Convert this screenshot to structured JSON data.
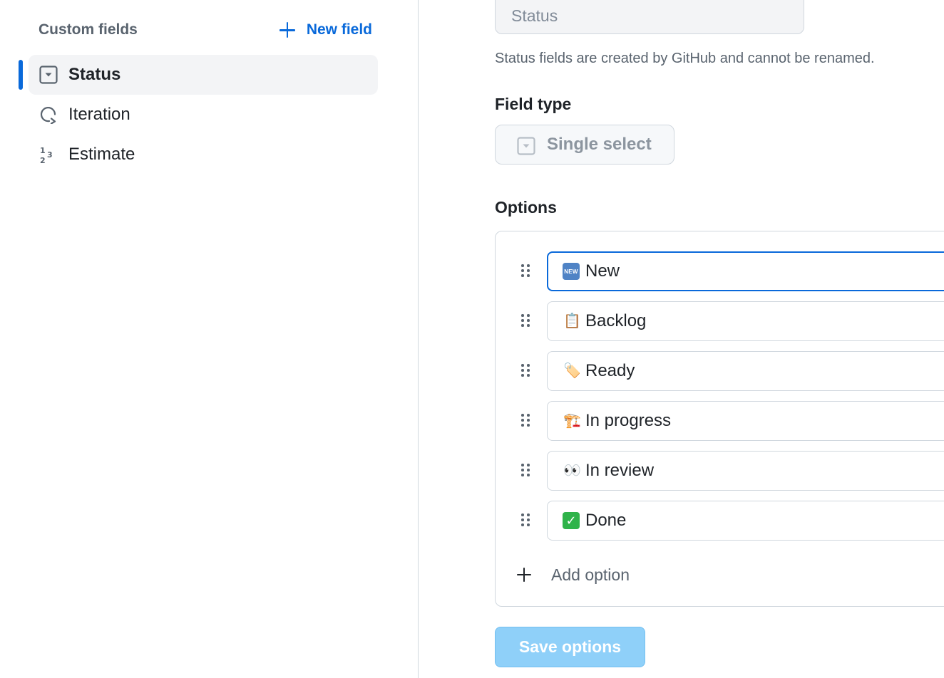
{
  "sidebar": {
    "title": "Custom fields",
    "new_field_label": "New field",
    "items": [
      {
        "label": "Status",
        "icon": "single-select-icon",
        "active": true
      },
      {
        "label": "Iteration",
        "icon": "iteration-icon",
        "active": false
      },
      {
        "label": "Estimate",
        "icon": "number-icon",
        "active": false
      }
    ]
  },
  "field": {
    "name_value": "Status",
    "note": "Status fields are created by GitHub and cannot be renamed.",
    "type_heading": "Field type",
    "type_value": "Single select"
  },
  "options": {
    "heading": "Options",
    "items": [
      {
        "emoji": "🆕",
        "label": "New",
        "focused": true
      },
      {
        "emoji": "📋",
        "label": "Backlog"
      },
      {
        "emoji": "🏷️",
        "label": "Ready"
      },
      {
        "emoji": "🏗️",
        "label": "In progress"
      },
      {
        "emoji": "👀",
        "label": "In review"
      },
      {
        "emoji": "✅",
        "label": "Done"
      }
    ],
    "add_label": "Add option",
    "save_label": "Save options"
  },
  "colors": {
    "accent": "#0969da",
    "save_disabled": "#8fd0f9",
    "muted_text": "#59636e"
  }
}
